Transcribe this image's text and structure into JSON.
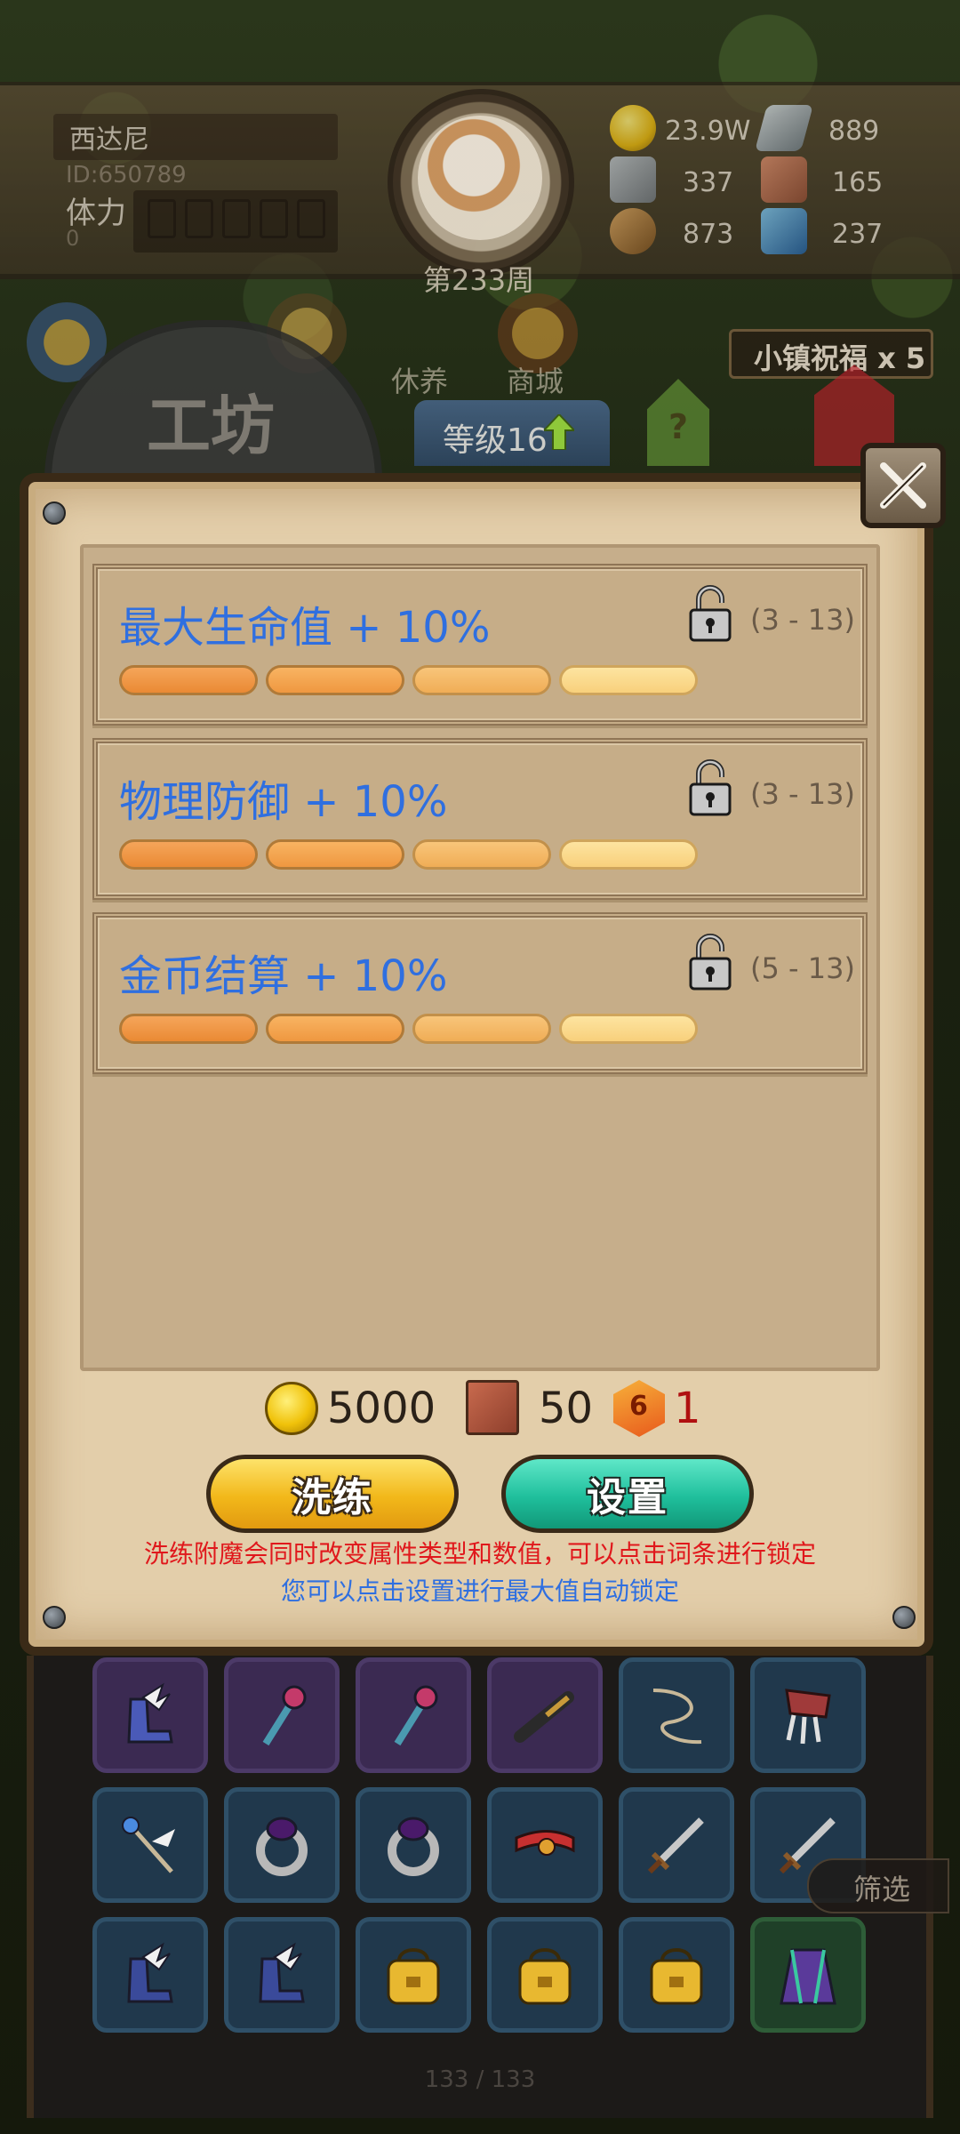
{
  "header": {
    "player_name": "西达尼",
    "player_id": "ID:650789",
    "stamina_label": "体力",
    "stamina_value": "0",
    "week_label": "第233周",
    "resources": [
      {
        "name": "gold-coin",
        "value": "23.9W"
      },
      {
        "name": "iron-ingot",
        "value": "889"
      },
      {
        "name": "stone",
        "value": "337"
      },
      {
        "name": "scroll",
        "value": "165"
      },
      {
        "name": "wood-log",
        "value": "873"
      },
      {
        "name": "blue-crystal",
        "value": "237"
      }
    ]
  },
  "nav": {
    "rest_label": "休养",
    "shop_label": "商城",
    "blessing": "小镇祝福 x 5",
    "workshop_title": "工坊",
    "level_label": "等级16",
    "help_label": "?"
  },
  "enchant": {
    "attributes": [
      {
        "name": "最大生命值 + 10%",
        "range": "(3 - 13)",
        "bars": 4
      },
      {
        "name": "物理防御 + 10%",
        "range": "(3 - 13)",
        "bars": 4
      },
      {
        "name": "金币结算 + 10%",
        "range": "(5 - 13)",
        "bars": 4
      }
    ],
    "cost": {
      "gold": "5000",
      "scroll": "50",
      "gem": "1",
      "gem_badge": "6"
    },
    "refine_button": "洗练",
    "settings_button": "设置",
    "hint_red": "洗练附魔会同时改变属性类型和数值，可以点击词条进行锁定",
    "hint_blue": "您可以点击设置进行最大值自动锁定"
  },
  "inventory": {
    "filter_label": "筛选",
    "page_count": "133 / 133",
    "rows": [
      [
        {
          "icon": "winged-boots-icon",
          "rarity": "purple"
        },
        {
          "icon": "gem-staff-icon",
          "rarity": "purple"
        },
        {
          "icon": "gem-staff-icon",
          "rarity": "purple"
        },
        {
          "icon": "spyglass-icon",
          "rarity": "purple"
        },
        {
          "icon": "whip-icon",
          "rarity": "blue"
        },
        {
          "icon": "red-claw-icon",
          "rarity": "blue"
        }
      ],
      [
        {
          "icon": "winged-wand-icon",
          "rarity": "blue"
        },
        {
          "icon": "purple-ring-icon",
          "rarity": "blue"
        },
        {
          "icon": "purple-ring-icon",
          "rarity": "blue"
        },
        {
          "icon": "red-belt-icon",
          "rarity": "blue"
        },
        {
          "icon": "sword-icon",
          "rarity": "blue"
        },
        {
          "icon": "sword-icon",
          "rarity": "blue"
        }
      ],
      [
        {
          "icon": "winged-boots-icon",
          "rarity": "blue"
        },
        {
          "icon": "winged-boots-icon",
          "rarity": "blue"
        },
        {
          "icon": "yellow-bag-icon",
          "rarity": "blue"
        },
        {
          "icon": "yellow-bag-icon",
          "rarity": "blue"
        },
        {
          "icon": "yellow-bag-icon",
          "rarity": "blue"
        },
        {
          "icon": "cloak-icon",
          "rarity": "green"
        }
      ]
    ]
  }
}
